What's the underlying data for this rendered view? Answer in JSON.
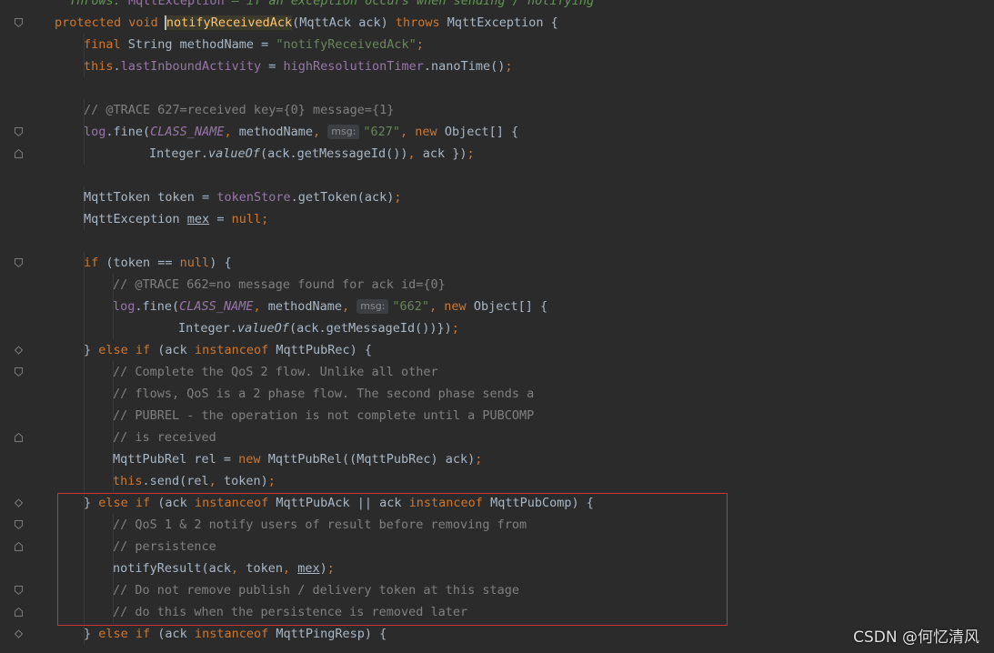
{
  "colors": {
    "background": "#2b2b2b",
    "keyword": "#cc7832",
    "string": "#6a8759",
    "comment": "#808080",
    "field": "#9876aa",
    "method": "#ffc66d",
    "default": "#a9b7c6",
    "highlight_border": "#cc3333"
  },
  "icons": {
    "fold_marker": "fold-marker-icon"
  },
  "lines": [
    [
      [
        "javadoc",
        "Throws: "
      ],
      [
        "fld",
        "MqttException"
      ],
      [
        "javadoc",
        " – if an exception occurs when sending / notifying"
      ]
    ],
    [
      [
        "kw",
        "protected void "
      ],
      [
        "fnhl",
        "notifyReceivedAck"
      ],
      [
        "",
        "(MqttAck ack) "
      ],
      [
        "kw",
        "throws "
      ],
      [
        "",
        "MqttException {"
      ]
    ],
    [
      [
        "kw",
        "final "
      ],
      [
        "",
        "String methodName = "
      ],
      [
        "str",
        "\"notifyReceivedAck\""
      ],
      [
        "kw",
        ";"
      ]
    ],
    [
      [
        "kw",
        "this"
      ],
      [
        "",
        "."
      ],
      [
        "fld",
        "lastInboundActivity"
      ],
      [
        "",
        " = "
      ],
      [
        "fld",
        "highResolutionTimer"
      ],
      [
        "",
        ".nanoTime()"
      ],
      [
        "kw",
        ";"
      ]
    ],
    [],
    [
      [
        "cmt",
        "// @TRACE 627=received key={0} message={1}"
      ]
    ],
    [
      [
        "fld",
        "log"
      ],
      [
        "",
        ".fine("
      ],
      [
        "cst",
        "CLASS_NAME"
      ],
      [
        "kw",
        ", "
      ],
      [
        "",
        "methodName"
      ],
      [
        "kw",
        ", "
      ],
      [
        "hint",
        "msg:"
      ],
      [
        "str",
        "\"627\""
      ],
      [
        "kw",
        ", new "
      ],
      [
        "",
        "Object[] {"
      ]
    ],
    [
      [
        "",
        "Integer."
      ],
      [
        "it",
        "valueOf"
      ],
      [
        "",
        "(ack.getMessageId())"
      ],
      [
        "kw",
        ", "
      ],
      [
        "",
        "ack })"
      ],
      [
        "kw",
        ";"
      ]
    ],
    [],
    [
      [
        "",
        "MqttToken token = "
      ],
      [
        "fld",
        "tokenStore"
      ],
      [
        "",
        ".getToken(ack)"
      ],
      [
        "kw",
        ";"
      ]
    ],
    [
      [
        "",
        "MqttException "
      ],
      [
        "ul",
        "mex"
      ],
      [
        "",
        " = "
      ],
      [
        "kw",
        "null;"
      ]
    ],
    [],
    [
      [
        "kw",
        "if "
      ],
      [
        "",
        "(token == "
      ],
      [
        "kw",
        "null"
      ],
      [
        "",
        ") {"
      ]
    ],
    [
      [
        "cmt",
        "// @TRACE 662=no message found for ack id={0}"
      ]
    ],
    [
      [
        "fld",
        "log"
      ],
      [
        "",
        ".fine("
      ],
      [
        "cst",
        "CLASS_NAME"
      ],
      [
        "kw",
        ", "
      ],
      [
        "",
        "methodName"
      ],
      [
        "kw",
        ", "
      ],
      [
        "hint",
        "msg:"
      ],
      [
        "str",
        "\"662\""
      ],
      [
        "kw",
        ", new "
      ],
      [
        "",
        "Object[] {"
      ]
    ],
    [
      [
        "",
        "Integer."
      ],
      [
        "it",
        "valueOf"
      ],
      [
        "",
        "(ack.getMessageId())})"
      ],
      [
        "kw",
        ";"
      ]
    ],
    [
      [
        "",
        "} "
      ],
      [
        "kw",
        "else if "
      ],
      [
        "",
        "(ack "
      ],
      [
        "kw",
        "instanceof "
      ],
      [
        "",
        "MqttPubRec) {"
      ]
    ],
    [
      [
        "cmt",
        "// Complete the QoS 2 flow. Unlike all other"
      ]
    ],
    [
      [
        "cmt",
        "// flows, QoS is a 2 phase flow. The second phase sends a"
      ]
    ],
    [
      [
        "cmt",
        "// PUBREL - the operation is not complete until a PUBCOMP"
      ]
    ],
    [
      [
        "cmt",
        "// is received"
      ]
    ],
    [
      [
        "",
        "MqttPubRel rel = "
      ],
      [
        "kw",
        "new "
      ],
      [
        "",
        "MqttPubRel((MqttPubRec) ack)"
      ],
      [
        "kw",
        ";"
      ]
    ],
    [
      [
        "kw",
        "this"
      ],
      [
        "",
        ".send(rel"
      ],
      [
        "kw",
        ", "
      ],
      [
        "",
        "token)"
      ],
      [
        "kw",
        ";"
      ]
    ],
    [
      [
        "",
        "} "
      ],
      [
        "kw",
        "else if "
      ],
      [
        "",
        "(ack "
      ],
      [
        "kw",
        "instanceof "
      ],
      [
        "",
        "MqttPubAck || ack "
      ],
      [
        "kw",
        "instanceof "
      ],
      [
        "",
        "MqttPubComp) {"
      ]
    ],
    [
      [
        "cmt",
        "// QoS 1 & 2 notify users of result before removing from"
      ]
    ],
    [
      [
        "cmt",
        "// persistence"
      ]
    ],
    [
      [
        "",
        "notifyResult(ack"
      ],
      [
        "kw",
        ", "
      ],
      [
        "",
        "token"
      ],
      [
        "kw",
        ", "
      ],
      [
        "ul",
        "mex"
      ],
      [
        "",
        ")"
      ],
      [
        "kw",
        ";"
      ]
    ],
    [
      [
        "cmt",
        "// Do not remove publish / delivery token at this stage"
      ]
    ],
    [
      [
        "cmt",
        "// do this when the persistence is removed later"
      ]
    ],
    [
      [
        "",
        "} "
      ],
      [
        "kw",
        "else if "
      ],
      [
        "",
        "(ack "
      ],
      [
        "kw",
        "instanceof "
      ],
      [
        "",
        "MqttPingResp) {"
      ]
    ]
  ],
  "watermark": "CSDN @何忆清风"
}
